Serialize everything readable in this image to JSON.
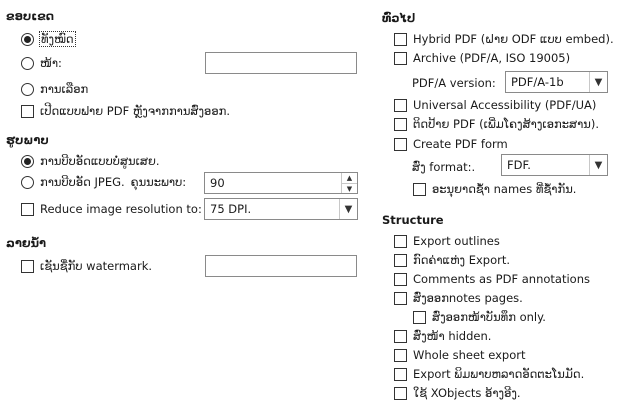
{
  "left": {
    "range": {
      "heading": "ຂອບເຂດ",
      "all": "ທັງໝົດ",
      "pages": "ໜ້າ:",
      "pages_value": "",
      "selection": "ການເລືອກ",
      "view_pdf_after_export": "ເປີດແບບຟາຍ PDF ຫຼັງຈາກການສົ່ງອອກ."
    },
    "images": {
      "heading": "ຮູບພາບ",
      "lossless": "ການບີບອັດແບບບໍ່ສູນເສຍ.",
      "jpeg": "ການບີບອັດ JPEG.",
      "quality_label": "ຄຸນນະພາບ:",
      "quality_value": "90",
      "reduce_resolution": "Reduce image resolution to:",
      "resolution_value": "75 DPI."
    },
    "watermark": {
      "heading": "ລາຍນ້ຳ",
      "sign_with_watermark": "ເຊັນຊື່ກັບ watermark.",
      "watermark_value": ""
    }
  },
  "right": {
    "general": {
      "heading": "ທົ່ວໄປ",
      "hybrid_pdf": "Hybrid PDF (ຝາຍ ODF ແບບ embed).",
      "archive": "Archive (PDF/A, ISO 19005)",
      "pdfa_version_label": "PDF/A version:",
      "pdfa_version_value": "PDF/A-1b",
      "universal_accessibility": "Universal Accessibility (PDF/UA)",
      "tagged_pdf": "ຕິດປ້າຍ PDF (ເພີ່ມໂຄງສ້າງເອກະສານ).",
      "create_pdf_form": "Create PDF form",
      "submit_format_label": "ສົ່ງ format:.",
      "submit_format_value": "FDF.",
      "allow_duplicate_names": "ອະນຸຍາດຊ້ຳ names ທີ່ຊ້ຳກັນ."
    },
    "structure": {
      "heading": "Structure",
      "export_outlines": "Export outlines",
      "export_placeholders": "ກົດຄ່າແຫ່ງ Export.",
      "comments_as_annotations": "Comments as PDF annotations",
      "export_notes_pages": "ສົ່ງອອກnotes pages.",
      "export_only_notes_pages": "ສົ່ງອອກໜ້າບັນທຶກ only.",
      "export_hidden_pages": "ສົ່ງໜ້າ hidden.",
      "whole_sheet_export": "Whole sheet export",
      "export_auto_inserted_blank": "Export ພິມພາບຫລາດອັດຕະໂນມັດ.",
      "use_reference_xobjects": "ໃຊ້ XObjects ອ້າງອີງ."
    }
  }
}
